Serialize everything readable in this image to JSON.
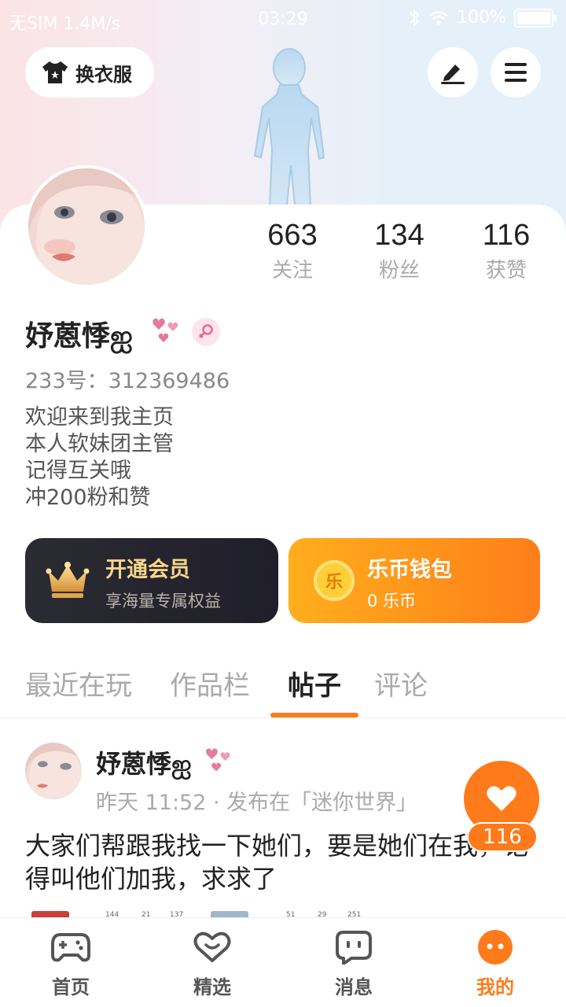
{
  "status_bar": {
    "carrier": "无SIM 1.4M/s",
    "time": "03:29",
    "battery": "100%",
    "battery_level": 1.0
  },
  "header": {
    "dress_button": "换衣服",
    "edit_icon": "pen-icon",
    "menu_icon": "hamburger-menu-icon"
  },
  "profile": {
    "stats": [
      {
        "value": "663",
        "label": "关注"
      },
      {
        "value": "134",
        "label": "粉丝"
      },
      {
        "value": "116",
        "label": "获赞"
      }
    ],
    "username": "妤蒽悸ஐ",
    "uid": "233号：312369486",
    "bio": "欢迎来到我主页\n本人软妹团主管\n记得互关哦\n冲200粉和赞",
    "gender_icon": "female-icon"
  },
  "cards": {
    "vip": {
      "title": "开通会员",
      "subtitle": "享海量专属权益"
    },
    "wallet": {
      "title": "乐币钱包",
      "subtitle": "0 乐币",
      "coin_char": "乐"
    }
  },
  "tabs": [
    {
      "label": "最近在玩",
      "active": false
    },
    {
      "label": "作品栏",
      "active": false
    },
    {
      "label": "帖子",
      "active": true
    },
    {
      "label": "评论",
      "active": false
    }
  ],
  "post": {
    "author": "妤蒽悸ஐ",
    "meta": "昨天 11:52 · 发布在「迷你世界」",
    "text": "大家们帮跟我找一下她们，要是她们在我，记得叫他们加我，求求了",
    "thumb_stats": [
      "144",
      "21",
      "137",
      "51",
      "29",
      "251"
    ]
  },
  "like": {
    "count": "116"
  },
  "bottom_nav": [
    {
      "label": "首页",
      "icon": "gamepad-icon",
      "active": false
    },
    {
      "label": "精选",
      "icon": "heart-chat-icon",
      "active": false
    },
    {
      "label": "消息",
      "icon": "message-icon",
      "active": false
    },
    {
      "label": "我的",
      "icon": "profile-face-icon",
      "active": true
    }
  ],
  "colors": {
    "accent": "#ff7a1a",
    "vip_gold": "#f7d58a"
  }
}
